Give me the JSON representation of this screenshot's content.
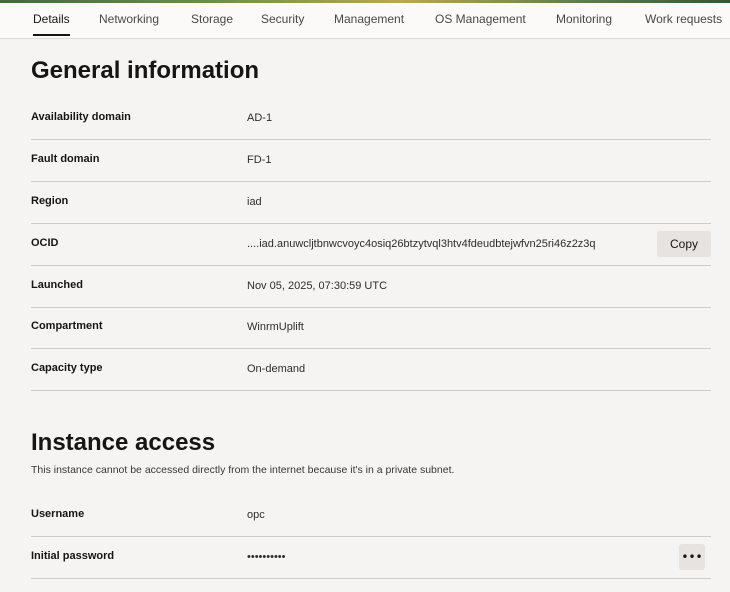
{
  "tabs": [
    {
      "label": "Details",
      "active": true
    },
    {
      "label": "Networking"
    },
    {
      "label": "Storage"
    },
    {
      "label": "Security"
    },
    {
      "label": "Management"
    },
    {
      "label": "OS Management"
    },
    {
      "label": "Monitoring"
    },
    {
      "label": "Work requests"
    }
  ],
  "general": {
    "title": "General information",
    "rows": [
      {
        "label": "Availability domain",
        "value": "AD-1"
      },
      {
        "label": "Fault domain",
        "value": "FD-1"
      },
      {
        "label": "Region",
        "value": "iad"
      },
      {
        "label": "OCID",
        "value": "....iad.anuwcljtbnwcvoyc4osiq26btzytvql3htv4fdeudbtejwfvn25ri46z2z3q"
      },
      {
        "label": "Launched",
        "value": "Nov 05, 2025, 07:30:59 UTC"
      },
      {
        "label": "Compartment",
        "value": "WinrmUplift"
      },
      {
        "label": "Capacity type",
        "value": "On-demand"
      }
    ],
    "copy_label": "Copy"
  },
  "access": {
    "title": "Instance access",
    "description": "This instance cannot be accessed directly from the internet because it's in a private subnet.",
    "rows": [
      {
        "label": "Username",
        "value": "opc"
      },
      {
        "label": "Initial password",
        "value": "••••••••••"
      }
    ],
    "more_label": "•••"
  },
  "colors": {
    "background": "#f5f4f2",
    "button": "#e6e3e0",
    "text": "#161513"
  }
}
